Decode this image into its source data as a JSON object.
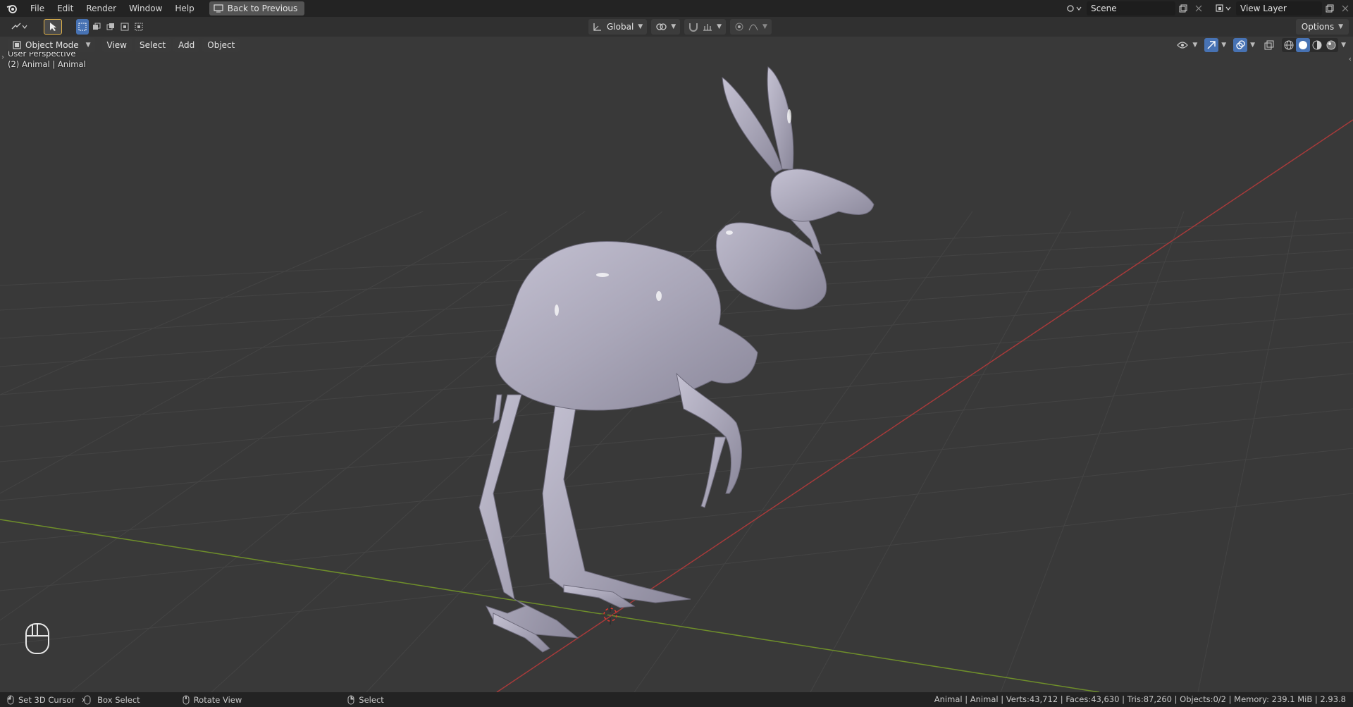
{
  "topbar": {
    "menu": [
      "File",
      "Edit",
      "Render",
      "Window",
      "Help"
    ],
    "back_button": "Back to Previous",
    "scene": "Scene",
    "view_layer": "View Layer"
  },
  "toolheader": {
    "orientation": "Global",
    "options": "Options"
  },
  "viewheader": {
    "mode": "Object Mode",
    "menus": [
      "View",
      "Select",
      "Add",
      "Object"
    ]
  },
  "viewport": {
    "perspective": "User Perspective",
    "object_info": "(2) Animal | Animal"
  },
  "statusbar": {
    "items": [
      "Set 3D Cursor",
      "Box Select",
      "Rotate View",
      "Select"
    ],
    "stats": "Animal | Animal | Verts:43,712 | Faces:43,630 | Tris:87,260 | Objects:0/2 | Memory: 239.1 MiB | 2.93.8"
  },
  "colors": {
    "x_axis": "#a83a3a",
    "y_axis": "#6f8f2a",
    "model": "#a9a6b8",
    "accent": "#4772b3"
  }
}
